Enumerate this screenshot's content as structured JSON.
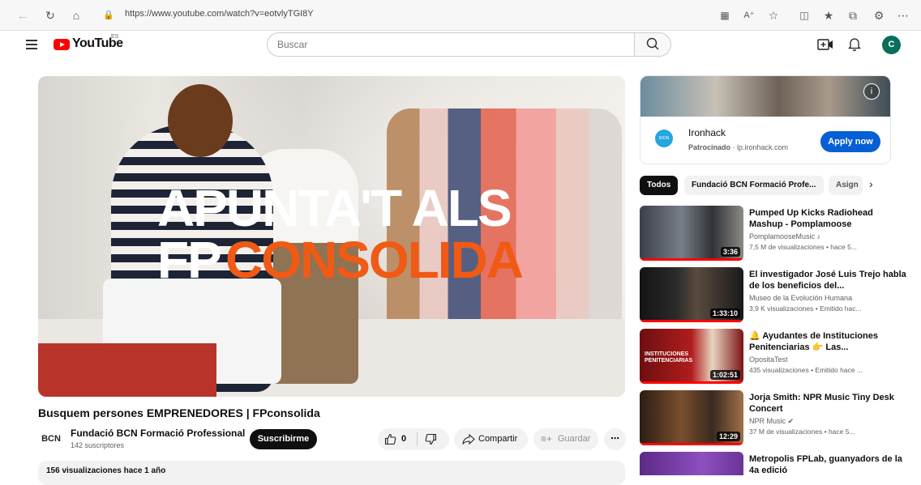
{
  "browser": {
    "url": "https://www.youtube.com/watch?v=eotvlyTGI8Y"
  },
  "header": {
    "logo_text": "YouTube",
    "region_code": "ES",
    "search_placeholder": "Buscar",
    "avatar_letter": "C",
    "colors": {
      "brand_red": "#ff0000",
      "avatar": "#0a6e5a"
    }
  },
  "video": {
    "overlay_line1": "APUNTA'T ALS",
    "overlay_line2_prefix": "FP",
    "overlay_line2_accent": "CONSOLIDA",
    "accent_color": "#f05a14",
    "title": "Busquem persones EMPRENEDORES | FPconsolida",
    "channel": {
      "logo_text": "BCN",
      "name": "Fundació BCN Formació Professional",
      "subscribers": "142 suscriptores"
    },
    "subscribe_label": "Suscribirme",
    "likes": "0",
    "share_label": "Compartir",
    "save_label": "Guardar",
    "description_meta": "156 visualizaciones  hace 1 año"
  },
  "ad": {
    "name": "Ironhack",
    "sponsored": "Patrocinado",
    "domain": "lp.ironhack.com",
    "logo_text": "IRON HACK",
    "cta": "Apply now",
    "info_icon": "i"
  },
  "chips": [
    "Todos",
    "Fundació BCN Formació Profe...",
    "Asign"
  ],
  "recommendations": [
    {
      "title": "Pumped Up Kicks Radiohead Mashup - Pomplamoose",
      "channel": "PomplamooseMusic ♪",
      "meta": "7,5 M de visualizaciones • hace 5...",
      "duration": "3:36"
    },
    {
      "title": "El investigador José Luis Trejo habla de los beneficios del...",
      "channel": "Museo de la Evolución Humana",
      "meta": "3,9 K visualizaciones • Emitido hac...",
      "duration": "1:33:10"
    },
    {
      "title": "🔔 Ayudantes de Instituciones Penitenciarias 👉 Las...",
      "channel": "OpositaTest",
      "meta": "435 visualizaciones • Emitido hace ...",
      "duration": "1:02:51",
      "thumb_text": "INSTITUCIONES PENITENCIARIAS"
    },
    {
      "title": "Jorja Smith: NPR Music Tiny Desk Concert",
      "channel": "NPR Music ✔",
      "meta": "37 M de visualizaciones • hace 5...",
      "duration": "12:29"
    },
    {
      "title": "Metropolis FPLab, guanyadors de la 4a edició",
      "channel": "",
      "meta": "",
      "duration": ""
    }
  ]
}
